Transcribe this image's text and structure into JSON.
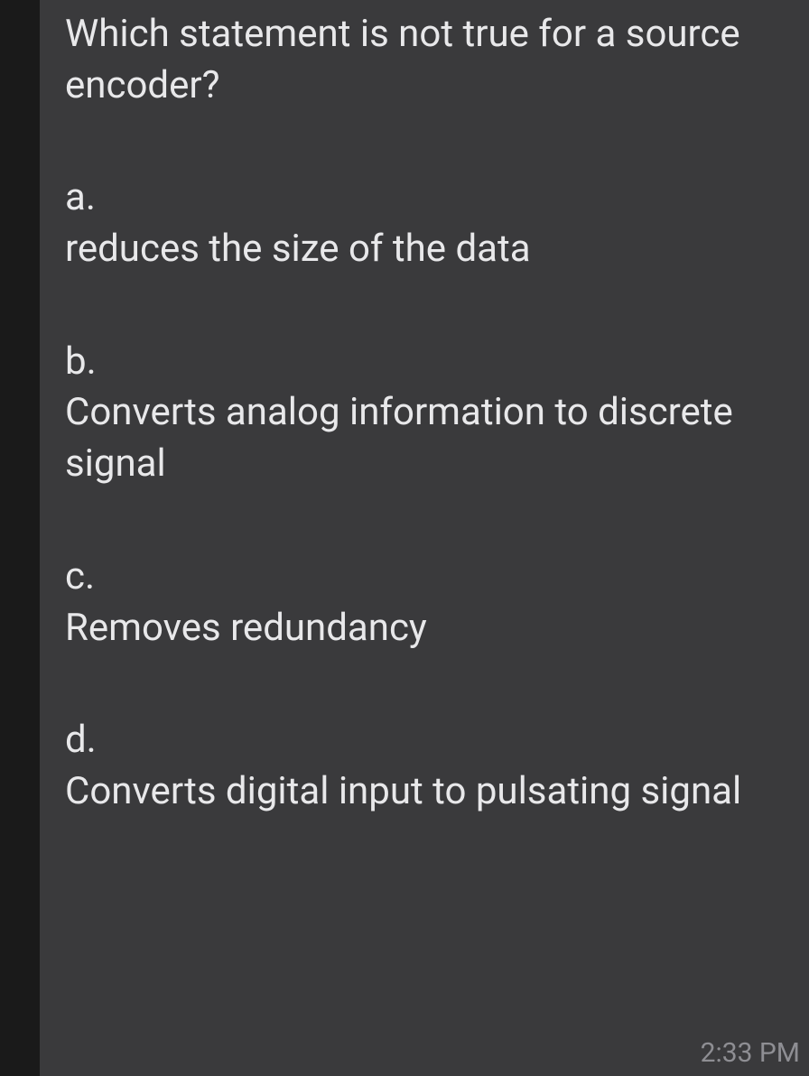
{
  "question": "Which statement is not true for a source encoder?",
  "options": [
    {
      "letter": "a.",
      "text": "reduces the size of the data"
    },
    {
      "letter": "b.",
      "text": "Converts analog information to discrete signal"
    },
    {
      "letter": "c.",
      "text": "Removes redundancy"
    },
    {
      "letter": "d.",
      "text": "Converts digital input to pulsating signal"
    }
  ],
  "timestamp": "2:33 PM"
}
